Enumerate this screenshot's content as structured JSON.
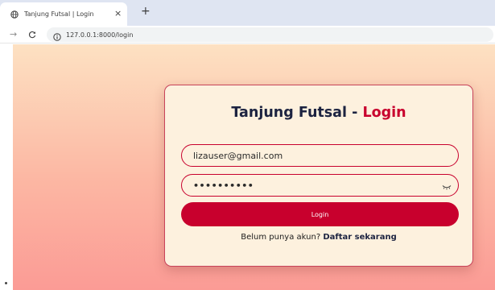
{
  "browser": {
    "tab_title": "Tanjung Futsal | Login",
    "tab_close": "×",
    "new_tab": "+",
    "url": "127.0.0.1:8000/login",
    "icons": {
      "favicon": "globe-icon",
      "close": "close-icon",
      "new_tab": "plus-icon",
      "forward": "arrow-forward-icon",
      "reload": "reload-icon",
      "site_info": "site-info-icon"
    }
  },
  "login": {
    "title_prefix": "Tanjung Futsal - ",
    "title_accent": "Login",
    "email_value": "lizauser@gmail.com",
    "password_mask": "••••••••••",
    "button_label": "Login",
    "register_prompt": "Belum punya akun? ",
    "register_link": "Daftar sekarang",
    "eye_icon": "eye-closed-icon"
  },
  "colors": {
    "accent": "#c8002d",
    "title": "#1c2340",
    "card_bg": "#fdf1de",
    "page_gradient_top": "#fde1c2",
    "page_gradient_bottom": "#fb9b95"
  }
}
